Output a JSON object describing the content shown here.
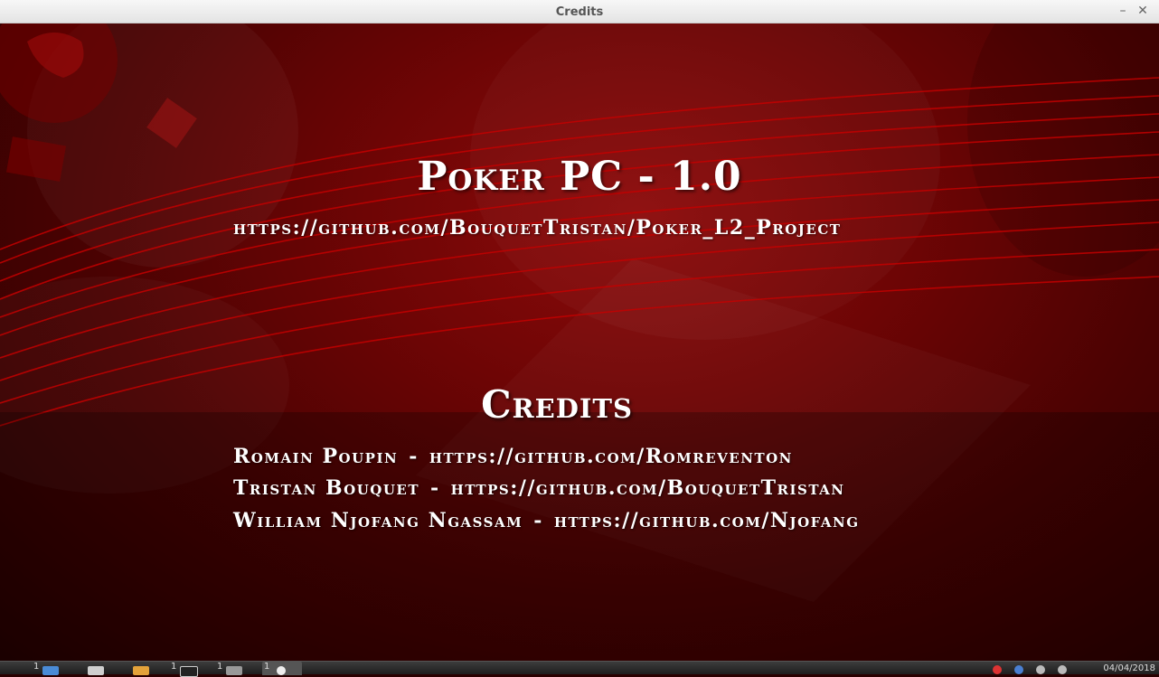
{
  "window": {
    "title": "Credits",
    "minimize_label": "–",
    "close_label": "✕"
  },
  "content": {
    "app_title": "Poker PC - 1.0",
    "project_url": "https://github.com/BouquetTristan/Poker_L2_Project",
    "credits_heading": "Credits",
    "credits": [
      {
        "name": "Romain Poupin",
        "separator": "-",
        "url": "https://github.com/Romreventon"
      },
      {
        "name": "Tristan Bouquet",
        "separator": "-",
        "url": "https://github.com/BouquetTristan"
      },
      {
        "name": "William Njofang Ngassam",
        "separator": "-",
        "url": "https://github.com/Njofang"
      }
    ]
  },
  "taskbar": {
    "items": [
      {
        "num": "1",
        "icon": "browser-icon",
        "active": false
      },
      {
        "num": "",
        "icon": "folder-icon",
        "active": false
      },
      {
        "num": "",
        "icon": "media-icon",
        "active": false
      },
      {
        "num": "1",
        "icon": "terminal-icon",
        "active": false
      },
      {
        "num": "1",
        "icon": "window-icon",
        "active": false
      },
      {
        "num": "1",
        "icon": "poker-chip-icon",
        "active": true
      }
    ],
    "clock": "04/04/2018"
  },
  "colors": {
    "background_dark": "#240000",
    "background_mid": "#6e0505",
    "text": "#ffffff",
    "stripe": "#c40000"
  }
}
